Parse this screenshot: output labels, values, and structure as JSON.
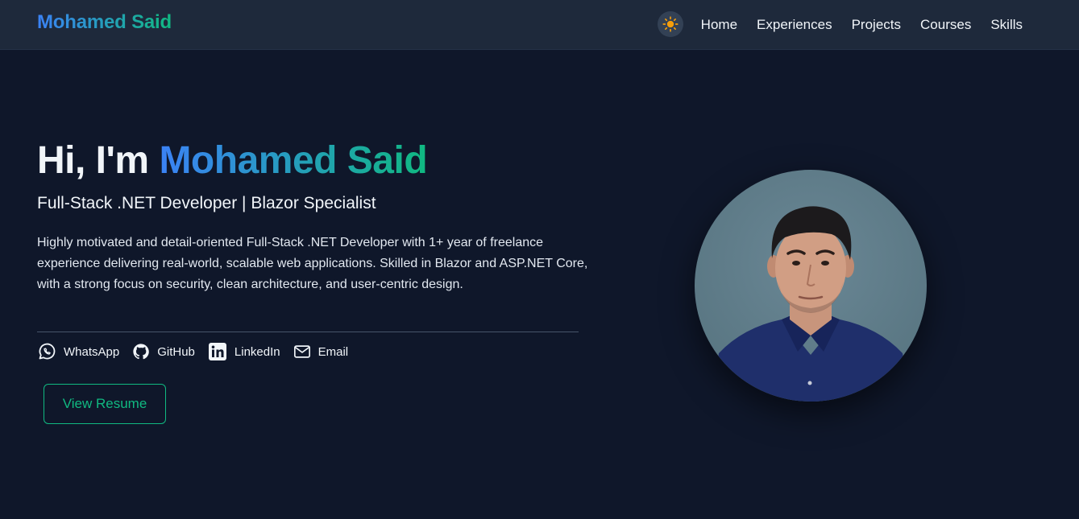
{
  "header": {
    "brand": "Mohamed Said",
    "theme_icon": "sun-icon",
    "nav": [
      "Home",
      "Experiences",
      "Projects",
      "Courses",
      "Skills"
    ]
  },
  "hero": {
    "greeting": "Hi, I'm ",
    "name": "Mohamed Said",
    "subtitle": "Full-Stack .NET Developer | Blazor Specialist",
    "bio": "Highly motivated and detail-oriented Full-Stack .NET Developer with 1+ year of freelance experience delivering real-world, scalable web applications. Skilled in Blazor and ASP.NET Core, with a strong focus on security, clean architecture, and user-centric design.",
    "socials": [
      {
        "label": "WhatsApp",
        "icon": "whatsapp-icon"
      },
      {
        "label": "GitHub",
        "icon": "github-icon"
      },
      {
        "label": "LinkedIn",
        "icon": "linkedin-icon"
      },
      {
        "label": "Email",
        "icon": "email-icon"
      }
    ],
    "resume_button": "View Resume",
    "avatar_icon": "profile-photo"
  },
  "colors": {
    "background": "#0f172a",
    "navbar": "#1e293b",
    "gradient_start": "#3b82f6",
    "gradient_end": "#10b981",
    "accent": "#10b981",
    "sun": "#f59e0b"
  }
}
